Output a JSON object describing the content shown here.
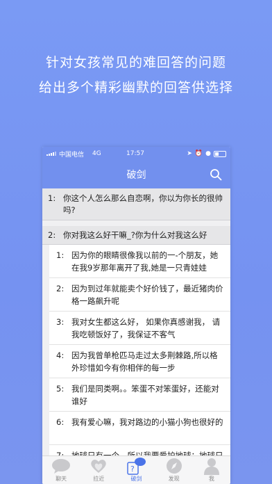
{
  "promo": {
    "line1": "针对女孩常见的难回答的问题",
    "line2": "给出多个精彩幽默的回答供选择"
  },
  "status_bar": {
    "carrier": "中国电信",
    "network": "4G",
    "time": "17:57"
  },
  "nav": {
    "title": "破剑"
  },
  "questions": [
    {
      "num": "1:",
      "text": "你这个人怎么那么自恋啊，你以为你长的很帅吗?"
    },
    {
      "num": "2:",
      "text": "你对我这么好干嘛_?你为什么对我这么好"
    }
  ],
  "answers": [
    {
      "num": "1:",
      "text": "因为你的眼睛很像我以前的一-个朋友，她在我9岁那年离开了我,她是一只青娃娃"
    },
    {
      "num": "2:",
      "text": "因为到过年就能卖个好价钱了，最近猪肉价格一路飙升呢"
    },
    {
      "num": "3:",
      "text": "我对女生都这么好， 如果你真感谢我， 请我吃顿饭好了，我保证不客气"
    },
    {
      "num": "4:",
      "text": "因为我曾单枪匹马走过太多荆棘路,所以格外珍惜如今有你相伴的每一步"
    },
    {
      "num": "5:",
      "text": "我们是同类啊。。笨蛋不对笨蛋好，还能对谁好"
    },
    {
      "num": "6:",
      "text": "我有爱心嘛，我对路边的小猫小狗也很好的"
    },
    {
      "num": "7:",
      "text": "地球只有一个，所以我要爱护地球；地球只有一个，所以我要爱护你"
    }
  ],
  "tabs": [
    {
      "label": "聊天",
      "icon": "chat-bubble-icon",
      "active": false
    },
    {
      "label": "拉近",
      "icon": "heart-icon",
      "active": false
    },
    {
      "label": "破剑",
      "icon": "sword-chat-icon",
      "active": true
    },
    {
      "label": "发现",
      "icon": "compass-icon",
      "active": false
    },
    {
      "label": "我",
      "icon": "person-icon",
      "active": false
    }
  ],
  "colors": {
    "accent": "#7290ee",
    "active_tab": "#4a73e8"
  }
}
